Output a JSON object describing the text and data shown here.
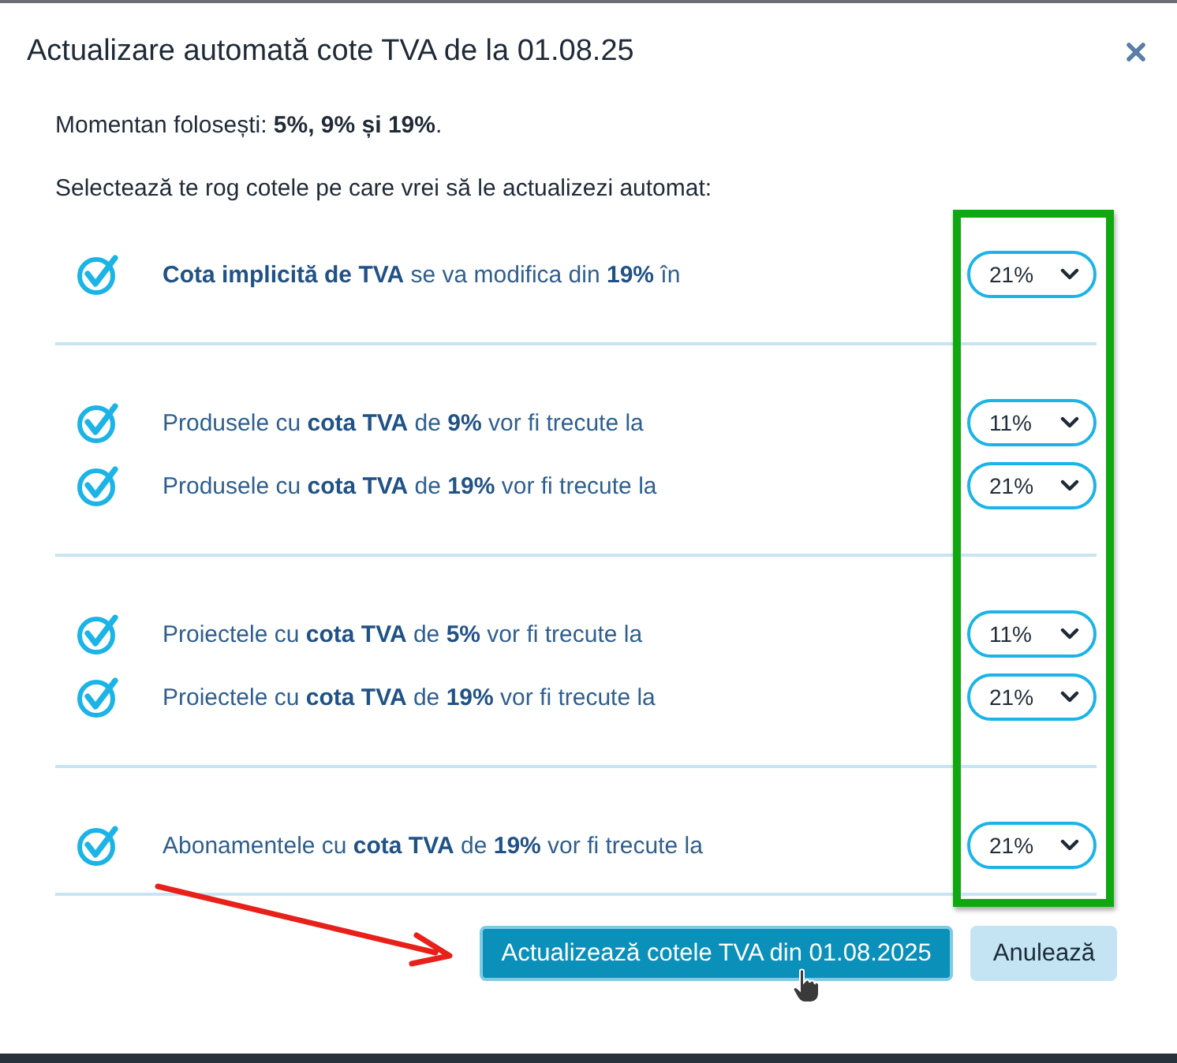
{
  "dialog": {
    "title": "Actualizare automată cote TVA de la 01.08.25"
  },
  "current_rates": "Momentan folosești: **5%, 9% și 19%**.",
  "instruction": "Selectează te rog cotele pe care vrei să le actualizezi automat:",
  "groups": [
    {
      "rows": [
        {
          "checked": true,
          "text": "**Cota implicită de TVA** se va modifica din **19%** în",
          "value": "21%"
        }
      ]
    },
    {
      "rows": [
        {
          "checked": true,
          "text": "Produsele cu **cota TVA** de **9%** vor fi trecute la",
          "value": "11%"
        },
        {
          "checked": true,
          "text": "Produsele cu **cota TVA** de **19%** vor fi trecute la",
          "value": "21%"
        }
      ]
    },
    {
      "rows": [
        {
          "checked": true,
          "text": "Proiectele cu **cota TVA** de **5%** vor fi trecute la",
          "value": "11%"
        },
        {
          "checked": true,
          "text": "Proiectele cu **cota TVA** de **19%** vor fi trecute la",
          "value": "21%"
        }
      ]
    },
    {
      "rows": [
        {
          "checked": true,
          "text": "Abonamentele cu **cota TVA** de **19%** vor fi trecute la",
          "value": "21%"
        }
      ]
    }
  ],
  "buttons": [
    {
      "kind": "primary",
      "label": "Actualizează cotele TVA din 01.08.2025"
    },
    {
      "kind": "secondary",
      "label": "Anulează"
    }
  ]
}
